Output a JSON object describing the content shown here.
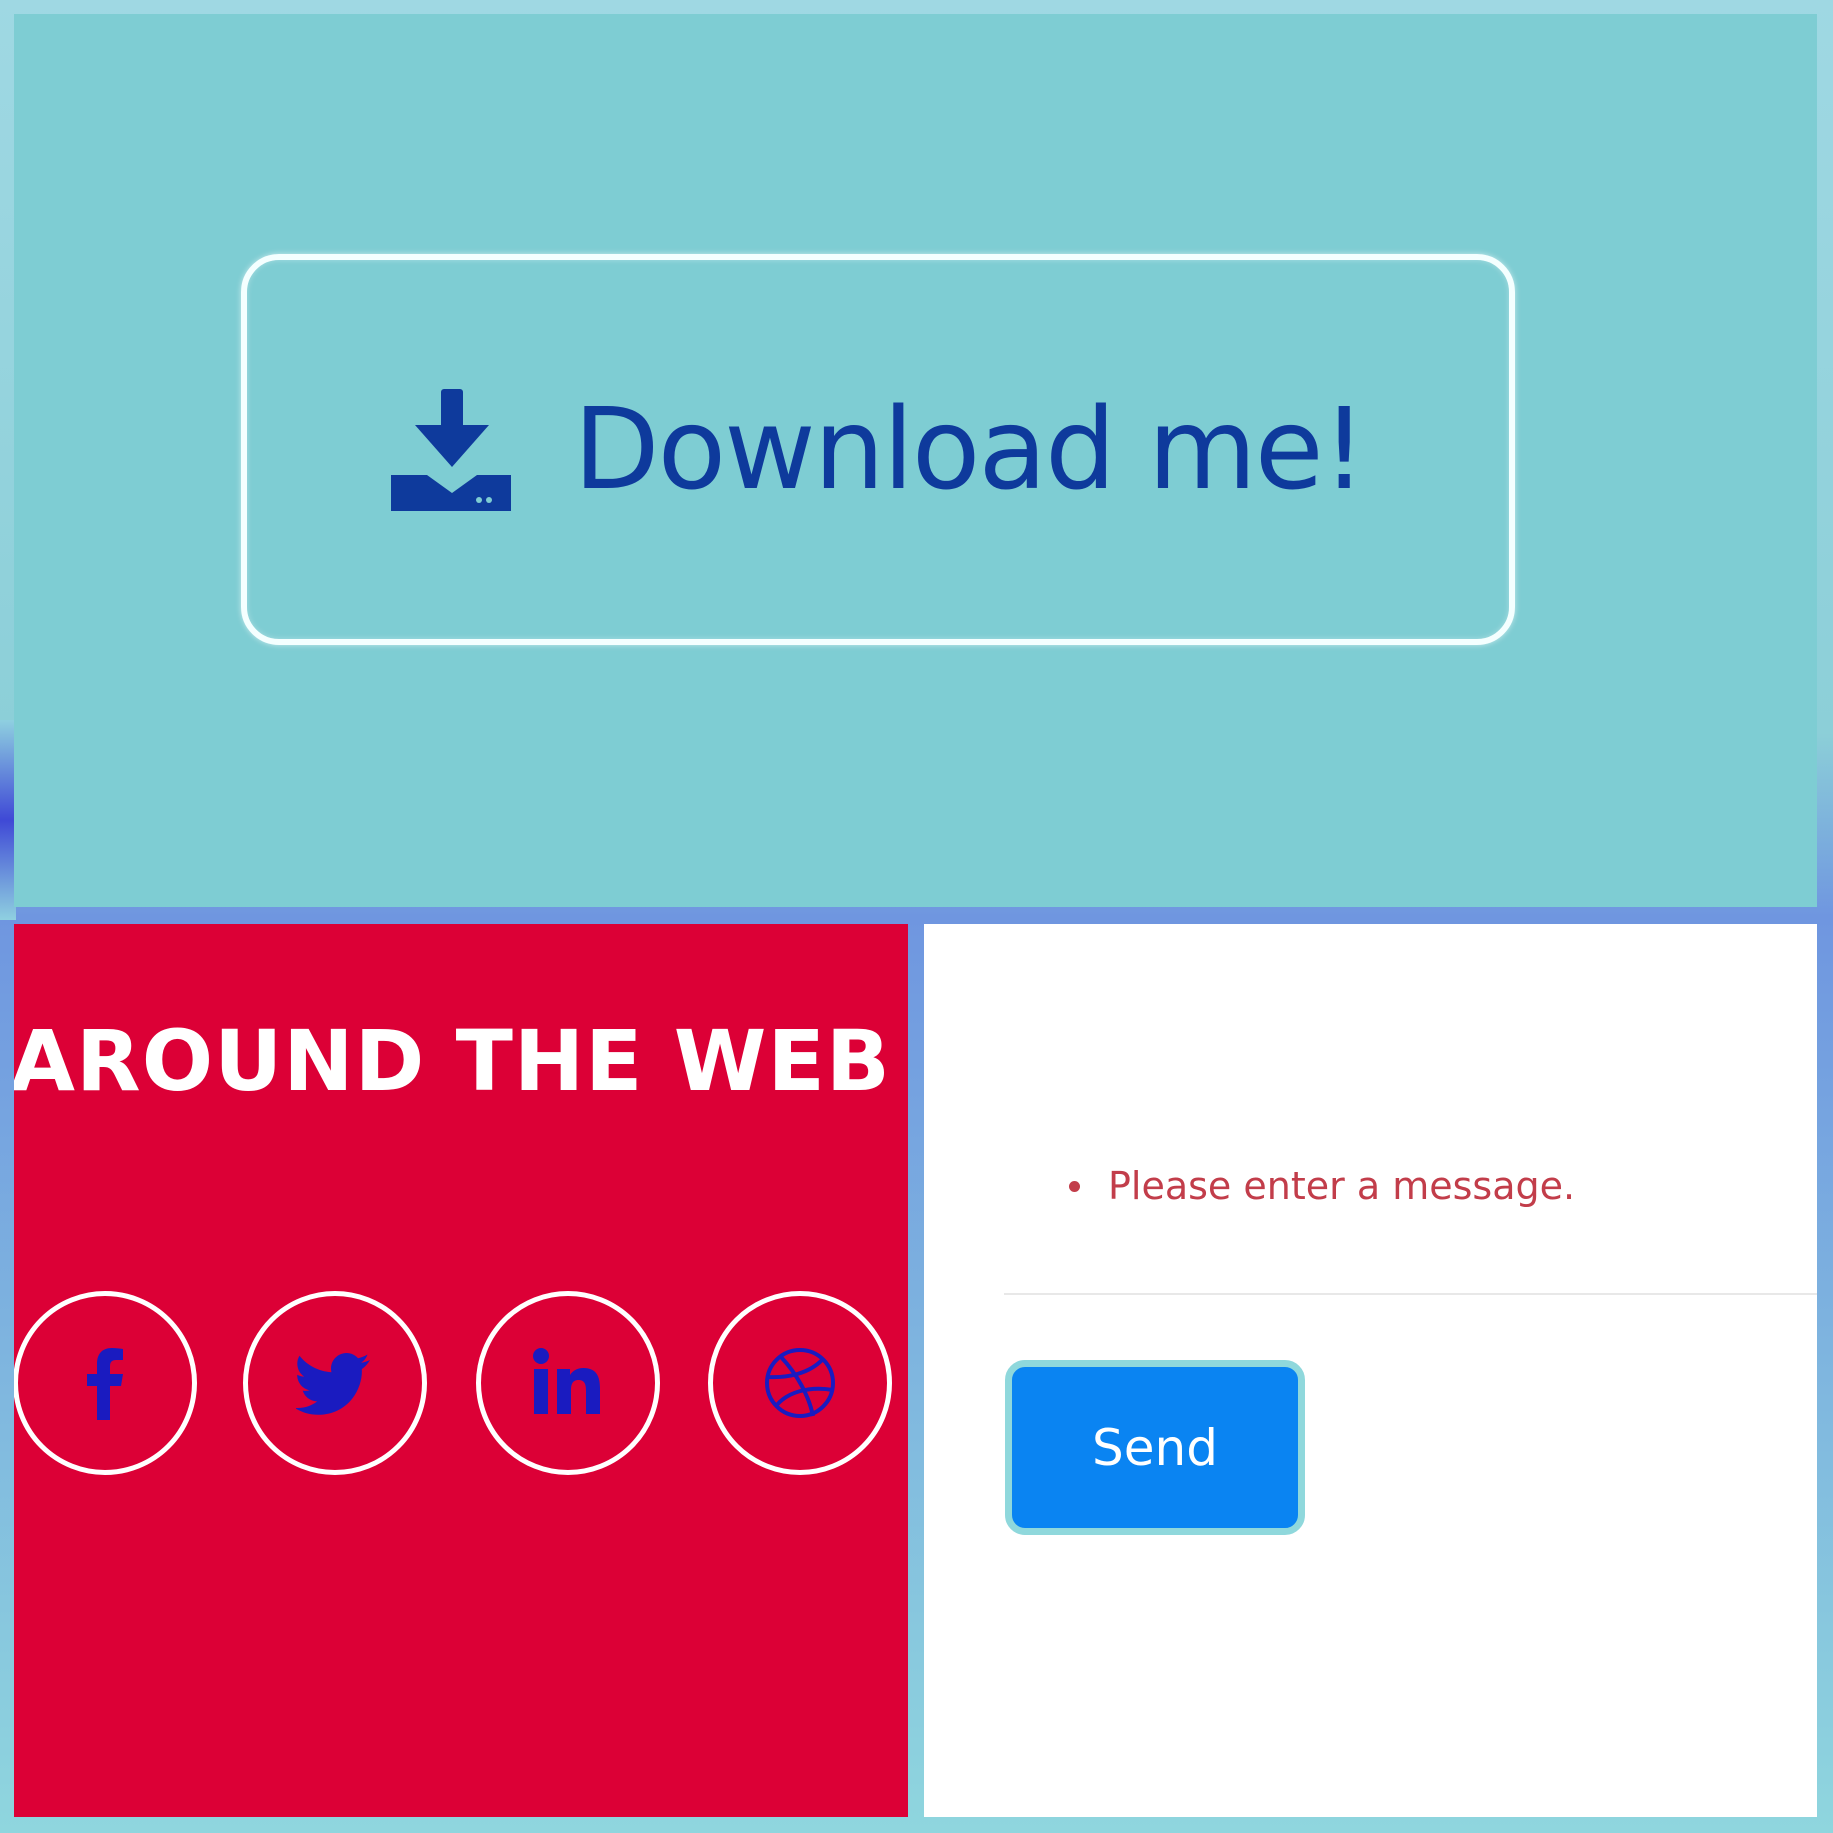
{
  "download": {
    "label": "Download me!",
    "icon": "download-icon"
  },
  "social": {
    "heading": "AROUND THE WEB",
    "items": [
      {
        "name": "facebook",
        "icon": "facebook-icon"
      },
      {
        "name": "twitter",
        "icon": "twitter-icon"
      },
      {
        "name": "linkedin",
        "icon": "linkedin-icon"
      },
      {
        "name": "dribbble",
        "icon": "dribbble-icon"
      }
    ]
  },
  "form": {
    "errors": [
      "Please enter a message."
    ],
    "send_label": "Send"
  },
  "colors": {
    "top_panel_bg": "#7ecdd3",
    "social_panel_bg": "#dc0036",
    "icon_blue": "#0e3a9c",
    "social_icon": "#1a1bc0",
    "error_text": "#c23d4a",
    "send_button_bg": "#0a84f2",
    "send_button_border": "#8fd8dc"
  }
}
